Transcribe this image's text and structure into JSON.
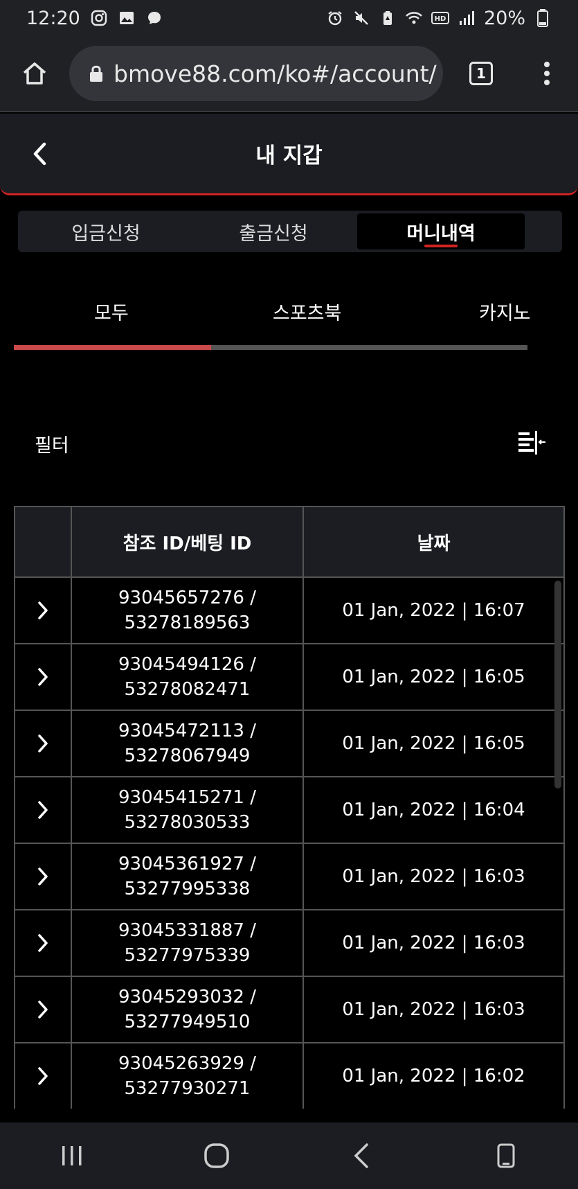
{
  "status": {
    "time": "12:20",
    "battery": "20%"
  },
  "browser": {
    "url": "bmove88.com/ko#/account/",
    "tab_count": "1"
  },
  "header": {
    "title": "내 지갑"
  },
  "main_tabs": [
    {
      "label": "입금신청"
    },
    {
      "label": "출금신청"
    },
    {
      "label": "머니내역"
    }
  ],
  "sub_tabs": [
    {
      "label": "모두"
    },
    {
      "label": "스포츠북"
    },
    {
      "label": "카지노"
    }
  ],
  "filter": {
    "label": "필터"
  },
  "table": {
    "columns": [
      "",
      "참조 ID/베팅 ID",
      "날짜"
    ],
    "rows": [
      {
        "ref": "93045657276 /",
        "bet": "53278189563",
        "date": "01 Jan, 2022 | 16:07"
      },
      {
        "ref": "93045494126 /",
        "bet": "53278082471",
        "date": "01 Jan, 2022 | 16:05"
      },
      {
        "ref": "93045472113 /",
        "bet": "53278067949",
        "date": "01 Jan, 2022 | 16:05"
      },
      {
        "ref": "93045415271 /",
        "bet": "53278030533",
        "date": "01 Jan, 2022 | 16:04"
      },
      {
        "ref": "93045361927 /",
        "bet": "53277995338",
        "date": "01 Jan, 2022 | 16:03"
      },
      {
        "ref": "93045331887 /",
        "bet": "53277975339",
        "date": "01 Jan, 2022 | 16:03"
      },
      {
        "ref": "93045293032 /",
        "bet": "53277949510",
        "date": "01 Jan, 2022 | 16:03"
      },
      {
        "ref": "93045263929 /",
        "bet": "53277930271",
        "date": "01 Jan, 2022 | 16:02"
      }
    ]
  },
  "colors": {
    "accent": "#d32222",
    "header_bg": "#1b1d22",
    "background": "#000000"
  }
}
